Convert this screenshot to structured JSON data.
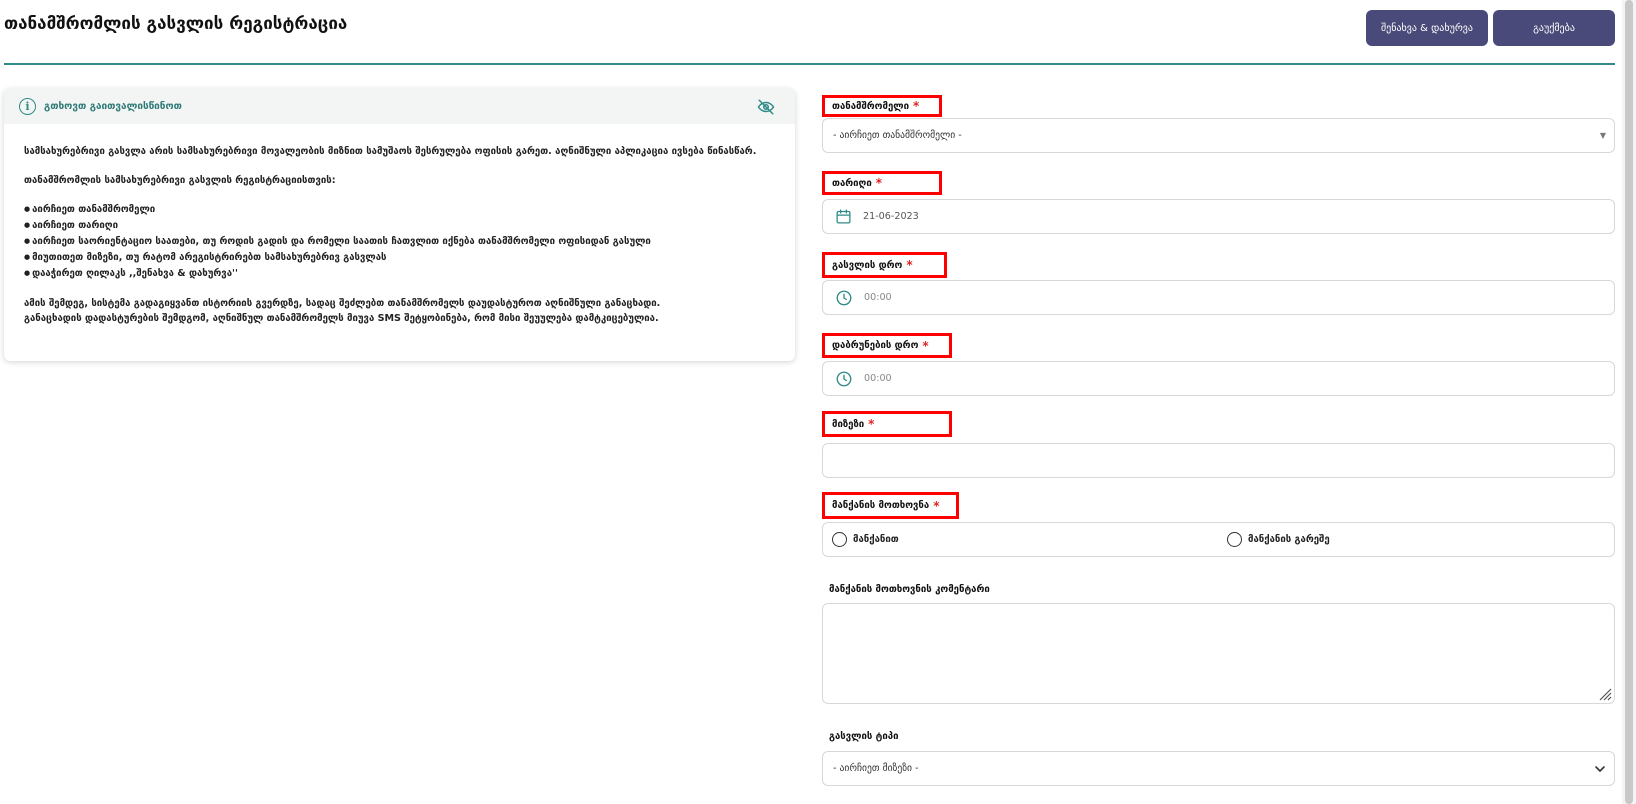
{
  "header": {
    "title": "თანამშრომლის გასვლის რეგისტრაცია",
    "save_label": "შენახვა & დახურვა",
    "cancel_label": "გაუქმება"
  },
  "info": {
    "title": "გთხოვთ გაითვალისწინოთ",
    "paragraph1": "სამსახურებრივი გასვლა არის სამსახურებრივი მოვალეობის მიზნით სამუშაოს შესრულება ოფისის გარეთ. აღნიშნული აპლიკაცია ივსება წინასწარ.",
    "paragraph2": "თანამშრომლის სამსახურებრივი გასვლის რეგისტრაციისთვის:",
    "bullets": [
      "აირჩიეთ თანამშრომელი",
      "აირჩიეთ თარიღი",
      "აირჩიეთ საორიენტაციო საათები, თუ როდის გადის და რომელი საათის ჩათვლით იქნება თანამშრომელი ოფისიდან გასული",
      "მიუთითეთ მიზეზი, თუ რატომ არეგისტრირებთ სამსახურებრივ გასვლას",
      "დააჭირეთ ღილაკს ,,შენახვა & დახურვა''"
    ],
    "paragraph3_line1": "ამის შემდეგ, სისტემა გადაგიყვანთ ისტორიის გვერდზე, სადაც შეძლებთ თანამშრომელს დაუდასტუროთ აღნიშნული განაცხადი.",
    "paragraph3_line2": "განაცხადის დადასტურების შემდგომ, აღნიშნულ თანამშრომელს მიუვა SMS შეტყობინება, რომ მისი შეუულება დამტკიცებულია."
  },
  "form": {
    "employee": {
      "label": "თანამშრომელი",
      "required": "*",
      "value": "- აირჩიეთ თანამშრომელი -"
    },
    "date": {
      "label": "თარიღი",
      "required": "*",
      "value": "21-06-2023"
    },
    "departure_time": {
      "label": "გასვლის დრო",
      "required": "*",
      "placeholder": "00:00"
    },
    "return_time": {
      "label": "დაბრუნების დრო",
      "required": "*",
      "placeholder": "00:00"
    },
    "reason": {
      "label": "მიზეზი",
      "required": "*",
      "value": ""
    },
    "car_request": {
      "label": "მანქანის მოთხოვნა",
      "required": "*",
      "options": [
        "მანქანით",
        "მანქანის გარეშე"
      ]
    },
    "car_comment": {
      "label": "მანქანის მოთხოვნის კომენტარი",
      "value": ""
    },
    "exit_type": {
      "label": "გასვლის ტიპი",
      "value": "- აირჩიეთ მიზეზი -"
    }
  },
  "colors": {
    "accent": "#2e8b86",
    "button": "#4a4a7a",
    "highlight": "#ff0000",
    "required": "#e02424"
  }
}
